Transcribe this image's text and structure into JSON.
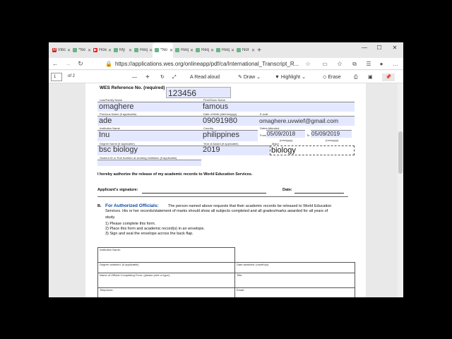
{
  "tabs": [
    {
      "label": "Inbo",
      "fav": "M",
      "color": "#c5221f",
      "active": false
    },
    {
      "label": "*No",
      "fav": "",
      "color": "#6bb38a",
      "active": false
    },
    {
      "label": "How",
      "fav": "▶",
      "color": "#e02020",
      "active": false
    },
    {
      "label": "My",
      "fav": "",
      "color": "#6bb38a",
      "active": false
    },
    {
      "label": "Req",
      "fav": "",
      "color": "#6bb38a",
      "active": false
    },
    {
      "label": "*No",
      "fav": "",
      "color": "#6bb38a",
      "active": true
    },
    {
      "label": "Req",
      "fav": "",
      "color": "#6bb38a",
      "active": false
    },
    {
      "label": "Req",
      "fav": "",
      "color": "#6bb38a",
      "active": false
    },
    {
      "label": "Req",
      "fav": "",
      "color": "#6bb38a",
      "active": false
    },
    {
      "label": "Not",
      "fav": "",
      "color": "#6bb38a",
      "active": false
    }
  ],
  "window": {
    "new_tab": "+",
    "minimize": "—",
    "maximize": "☐",
    "close": "✕"
  },
  "address": {
    "url": "https://applications.wes.org/onlineapp/pdf/ca/International_Transcript_R..."
  },
  "pdf_toolbar": {
    "page": "1",
    "of": "of 2",
    "zoom_out": "—",
    "zoom_in": "+",
    "read_aloud": "Read aloud",
    "draw": "Draw",
    "highlight": "Highlight",
    "erase": "Erase"
  },
  "form": {
    "wes_ref_label": "WES Reference No. (required)",
    "wes_ref_value": "123456",
    "last_name_label": "Last/Family Name",
    "last_name": "omaghere",
    "first_name_label": "First/Given Name",
    "first_name": "famous",
    "prev_name_label": "Previous Name (if applicable)",
    "prev_name": "ade",
    "dob_label": "Date of Birth (dd/mm/yyyy)",
    "dob": "09091980",
    "email_label": "E-mail",
    "email": "omaghere.uvwief@gmail.com",
    "inst_label": "Institution Name",
    "inst": "Inu",
    "country_label": "Country",
    "country": "philippines",
    "dates_label": "Dates Attended",
    "from_label": "From",
    "from": "05/09/2018",
    "to_label": "To",
    "to": "05/09/2019",
    "mmyyyy1": "(mm/yyyy)",
    "mmyyyy2": "(mm/yyyy)",
    "degree_label": "Degree Name (if applicable)",
    "degree": "bsc biology",
    "year_label": "Year of Award (if applicable)",
    "year": "2019",
    "major_label": "Major",
    "major": "biology",
    "student_id_label": "Student ID or Roll Number at sending institution (if applicable)",
    "authorize": "I hereby authorize the release of my academic records to World Education Services.",
    "signature_label": "Applicant's signature:",
    "date_label": "Date:",
    "section_b": "B.",
    "officials_title": "For Authorized Officials:",
    "officials_text_1": "The person named above requests that their academic records be released to World Education",
    "officials_text_2": "Services. His or her records/statement of marks should show all subjects completed and all grades/marks awarded for all years of",
    "officials_text_3": "study.",
    "step1": "1) Please complete this form.",
    "step2": "2) Place this form and academic record(s) in an envelope.",
    "step3": "3) Sign and seal the envelope across the back flap.",
    "t_inst": "Institution Name:",
    "t_degree": "Degree obtained: (if applicable)",
    "t_date_awarded": "Date awarded: (month/yr)",
    "t_official": "Name of Official Completing Form: (please print or type)",
    "t_title": "Title:",
    "t_phone": "Telephone:",
    "t_email": "Email:"
  },
  "colors": {
    "accent": "#0d47a1",
    "field_bg": "#e4e8ff"
  }
}
